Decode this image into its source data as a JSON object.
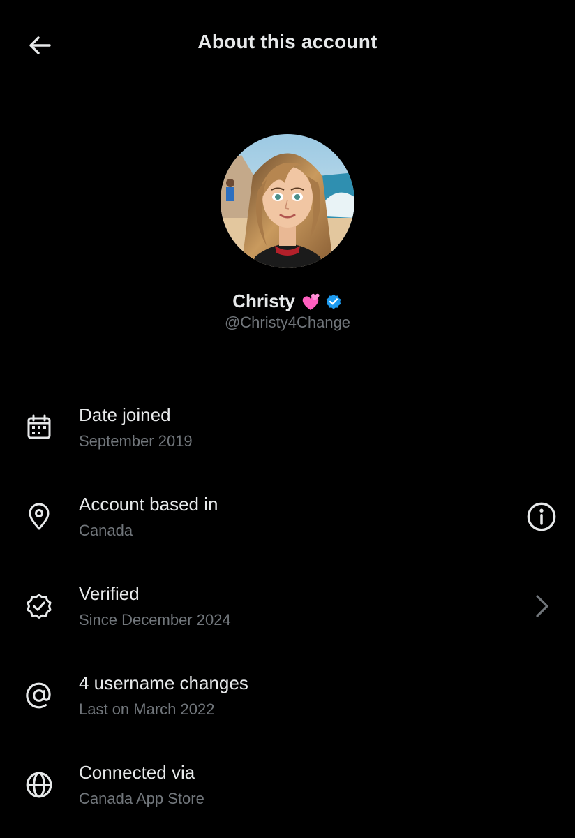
{
  "header": {
    "title": "About this account",
    "back_icon": "arrow-left-icon"
  },
  "profile": {
    "display_name": "Christy",
    "name_emoji": "two-hearts-emoji-icon",
    "verified_icon": "verified-badge-icon",
    "handle": "@Christy4Change",
    "avatar_icon": "profile-avatar-image"
  },
  "details": {
    "date_joined": {
      "label": "Date joined",
      "value": "September 2019",
      "icon": "calendar-icon"
    },
    "account_based": {
      "label": "Account based in",
      "value": "Canada",
      "icon": "location-pin-icon",
      "action_icon": "info-icon"
    },
    "verified": {
      "label": "Verified",
      "value": "Since December 2024",
      "icon": "verified-check-icon",
      "action_icon": "chevron-right-icon"
    },
    "username_changes": {
      "label": "4 username changes",
      "value": "Last on March 2022",
      "icon": "at-sign-icon"
    },
    "connected_via": {
      "label": "Connected via",
      "value": "Canada App Store",
      "icon": "globe-icon"
    }
  },
  "colors": {
    "background": "#000000",
    "primary_text": "#e7e9ea",
    "secondary_text": "#71767b",
    "verified_blue": "#1d9bf0",
    "emoji_pink": "#ff5fbf"
  }
}
